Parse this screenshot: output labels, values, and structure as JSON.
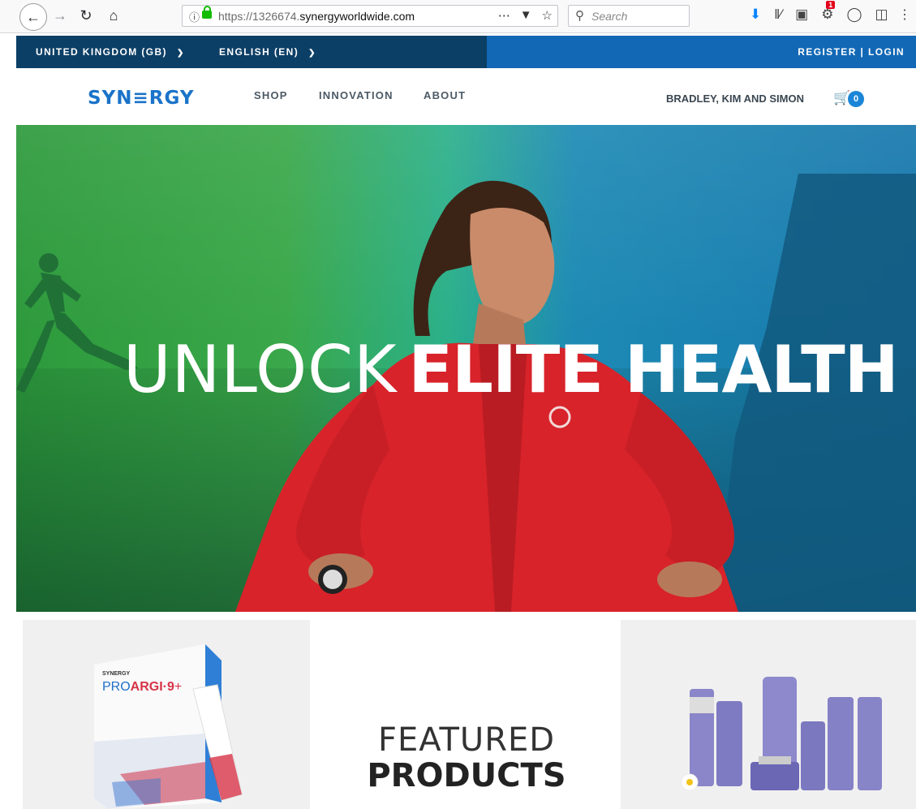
{
  "browser": {
    "url_prefix": "https://1326674.",
    "url_domain": "synergyworldwide.com",
    "search_placeholder": "Search",
    "notification_count": "1",
    "icons": [
      "back-icon",
      "forward-icon",
      "reload-icon",
      "home-icon",
      "info-icon",
      "lock-icon",
      "more-icon",
      "pocket-icon",
      "bookmark-star-icon",
      "search-icon",
      "download-icon",
      "library-icon",
      "extension-icon",
      "notification-icon",
      "shield-icon",
      "sidebar-icon",
      "overflow-icon"
    ]
  },
  "utility_bar": {
    "country": "UNITED KINGDOM (GB)",
    "language": "ENGLISH (EN)",
    "auth": "REGISTER | LOGIN"
  },
  "nav": {
    "logo": "SYN≡RGY",
    "links": [
      "SHOP",
      "INNOVATION",
      "ABOUT"
    ],
    "greeting": "BRADLEY, KIM AND SIMON",
    "cart_count": "0"
  },
  "hero": {
    "title_light": "UNLOCK",
    "title_bold": "ELITE HEALTH"
  },
  "featured": {
    "line1": "FEATURED",
    "line2": "PRODUCTS",
    "left_product": {
      "brand": "SYNERGY",
      "name_light": "PRO",
      "name_bold": "ARGI·9",
      "name_plus": "+"
    }
  },
  "colors": {
    "util_dark": "#0c3f66",
    "util_blue": "#1268b5",
    "logo": "#1a73c9",
    "cart_badge": "#1b86d8",
    "jacket": "#d8232a"
  }
}
